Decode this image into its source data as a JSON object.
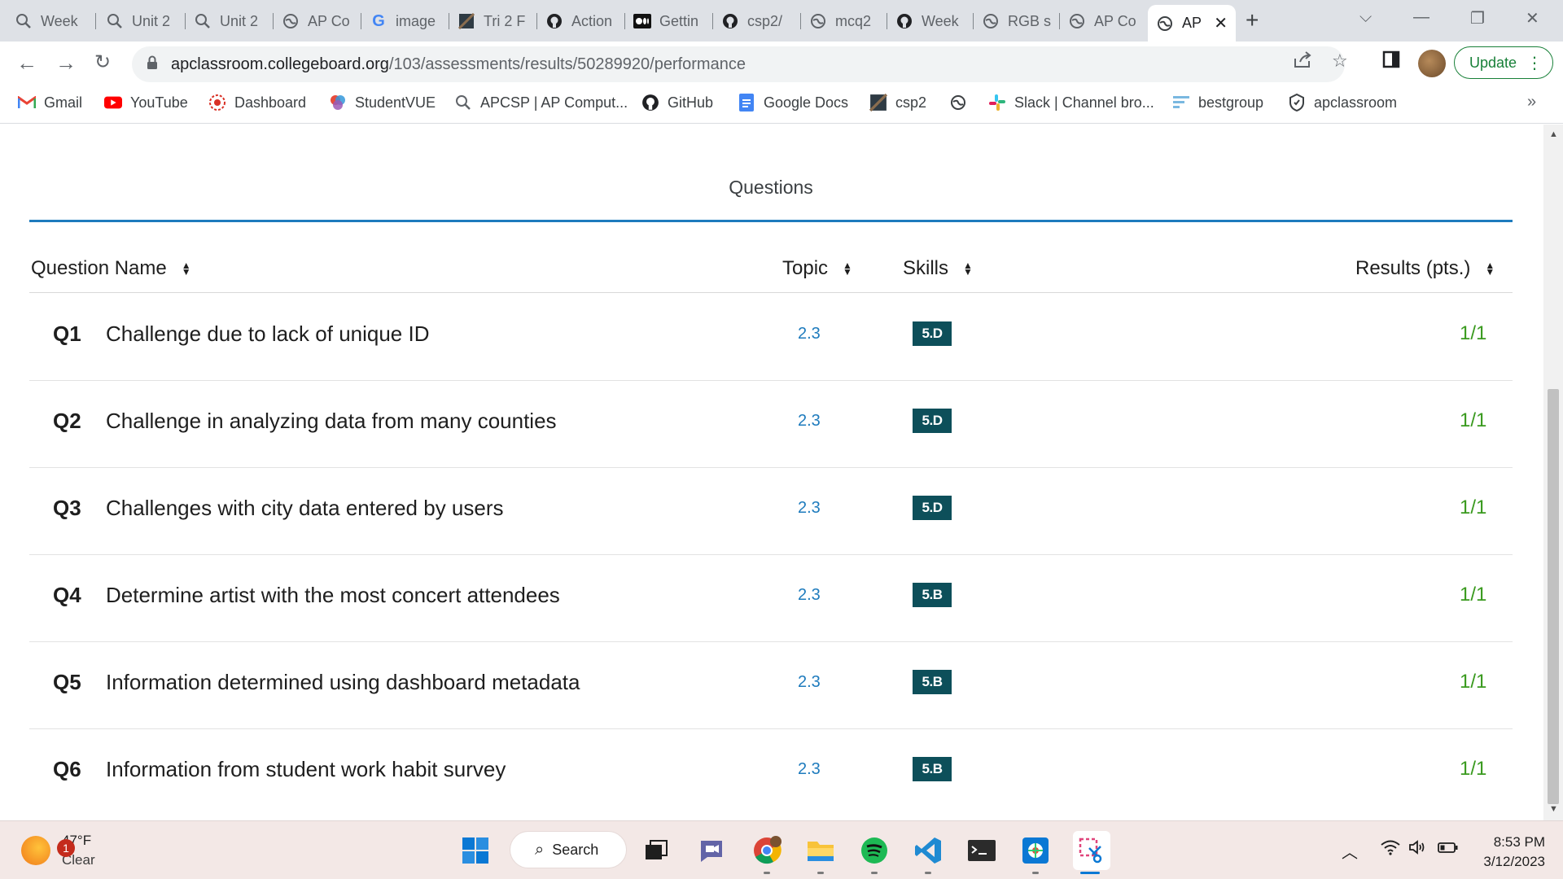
{
  "browser": {
    "tabs": [
      {
        "label": "Week",
        "icon": "quill-icon"
      },
      {
        "label": "Unit 2",
        "icon": "quill-icon"
      },
      {
        "label": "Unit 2",
        "icon": "quill-icon"
      },
      {
        "label": "AP Co",
        "icon": "globe-icon"
      },
      {
        "label": "image",
        "icon": "google-icon"
      },
      {
        "label": "Tri 2 F",
        "icon": "thumbnail-icon"
      },
      {
        "label": "Action",
        "icon": "github-icon"
      },
      {
        "label": "Gettin",
        "icon": "medium-icon"
      },
      {
        "label": "csp2/",
        "icon": "github-icon"
      },
      {
        "label": "mcq2",
        "icon": "globe-icon"
      },
      {
        "label": "Week",
        "icon": "github-icon"
      },
      {
        "label": "RGB s",
        "icon": "globe-icon"
      },
      {
        "label": "AP Co",
        "icon": "globe-icon"
      },
      {
        "label": "AP",
        "icon": "globe-icon",
        "active": true
      }
    ],
    "url_host": "apclassroom.collegeboard.org",
    "url_path": "/103/assessments/results/50289920/performance",
    "update_label": "Update",
    "bookmarks": [
      {
        "label": "Gmail",
        "icon": "gmail-icon"
      },
      {
        "label": "YouTube",
        "icon": "youtube-icon"
      },
      {
        "label": "Dashboard",
        "icon": "dashboard-icon"
      },
      {
        "label": "StudentVUE",
        "icon": "studentvue-icon"
      },
      {
        "label": "APCSP | AP Comput...",
        "icon": "quill-icon"
      },
      {
        "label": "GitHub",
        "icon": "github-icon"
      },
      {
        "label": "Google Docs",
        "icon": "docs-icon"
      },
      {
        "label": "csp2",
        "icon": "thumbnail-icon"
      },
      {
        "label": "",
        "icon": "globe-icon"
      },
      {
        "label": "Slack | Channel bro...",
        "icon": "slack-icon"
      },
      {
        "label": "bestgroup",
        "icon": "bestgroup-icon"
      },
      {
        "label": "apclassroom",
        "icon": "shield-icon"
      }
    ],
    "bookmarks_more": "»"
  },
  "page": {
    "section_tab": "Questions",
    "columns": {
      "name": "Question Name",
      "topic": "Topic",
      "skills": "Skills",
      "results": "Results (pts.)"
    },
    "rows": [
      {
        "id": "Q1",
        "name": "Challenge due to lack of unique ID",
        "topic": "2.3",
        "skill": "5.D",
        "result": "1/1"
      },
      {
        "id": "Q2",
        "name": "Challenge in analyzing data from many counties",
        "topic": "2.3",
        "skill": "5.D",
        "result": "1/1"
      },
      {
        "id": "Q3",
        "name": "Challenges with city data entered by users",
        "topic": "2.3",
        "skill": "5.D",
        "result": "1/1"
      },
      {
        "id": "Q4",
        "name": "Determine artist with the most concert attendees",
        "topic": "2.3",
        "skill": "5.B",
        "result": "1/1"
      },
      {
        "id": "Q5",
        "name": "Information determined using dashboard metadata",
        "topic": "2.3",
        "skill": "5.B",
        "result": "1/1"
      },
      {
        "id": "Q6",
        "name": "Information from student work habit survey",
        "topic": "2.3",
        "skill": "5.B",
        "result": "1/1"
      }
    ]
  },
  "taskbar": {
    "weather_temp": "47°F",
    "weather_condition": "Clear",
    "weather_badge": "1",
    "search_label": "Search",
    "time": "8:53 PM",
    "date": "3/12/2023"
  },
  "colors": {
    "accent_blue": "#1e7bbd",
    "skill_badge": "#0d4f5a",
    "result_green": "#3a9a1f",
    "update_green": "#188038"
  }
}
